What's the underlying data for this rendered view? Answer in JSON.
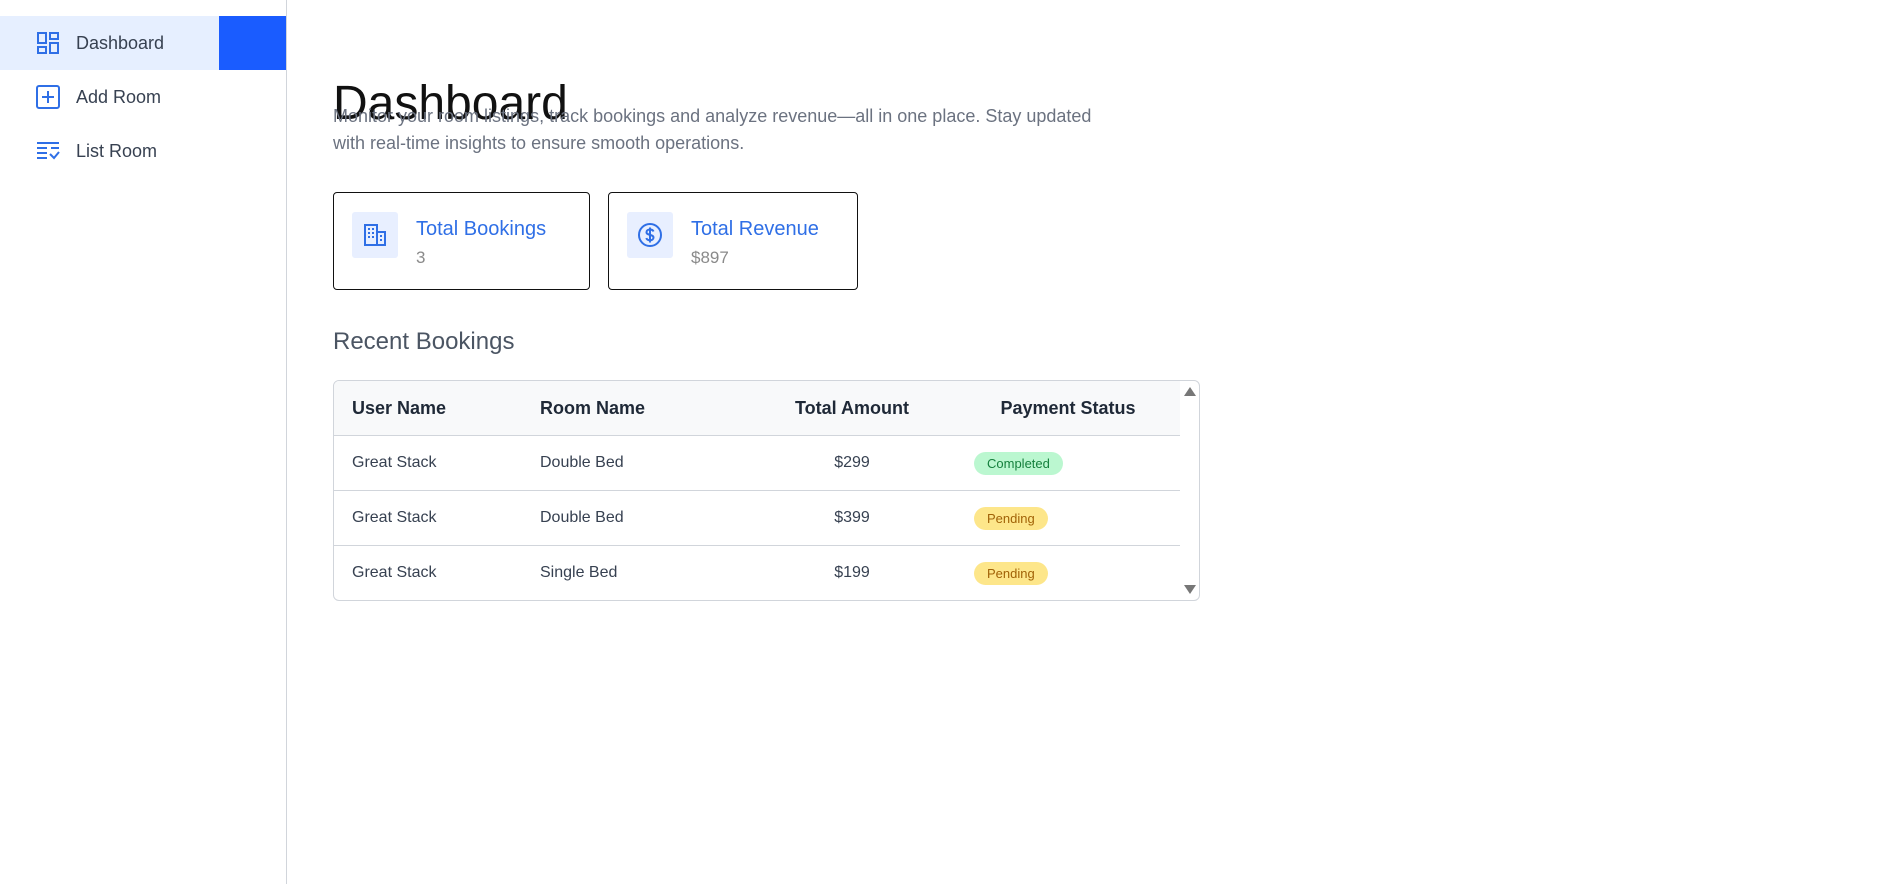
{
  "sidebar": {
    "items": [
      {
        "label": "Dashboard",
        "icon": "dashboard-icon",
        "active": true
      },
      {
        "label": "Add Room",
        "icon": "add-box-icon",
        "active": false
      },
      {
        "label": "List Room",
        "icon": "list-check-icon",
        "active": false
      }
    ]
  },
  "header": {
    "title": "Dashboard",
    "description": "Monitor your room listings, track bookings and analyze revenue—all in one place. Stay updated with real-time insights to ensure smooth operations."
  },
  "cards": {
    "bookings": {
      "title": "Total Bookings",
      "value": "3",
      "icon": "building-icon"
    },
    "revenue": {
      "title": "Total Revenue",
      "value": "$897",
      "icon": "dollar-circle-icon"
    }
  },
  "recent": {
    "title": "Recent Bookings",
    "columns": [
      "User Name",
      "Room Name",
      "Total Amount",
      "Payment Status"
    ],
    "rows": [
      {
        "user": "Great Stack",
        "room": "Double Bed",
        "amount": "$299",
        "status": "Completed"
      },
      {
        "user": "Great Stack",
        "room": "Double Bed",
        "amount": "$399",
        "status": "Pending"
      },
      {
        "user": "Great Stack",
        "room": "Single Bed",
        "amount": "$199",
        "status": "Pending"
      }
    ]
  },
  "colors": {
    "accent": "#1a5cff",
    "card_title": "#2f6fe6",
    "completed_bg": "#bbf7d0",
    "pending_bg": "#fde68a"
  }
}
